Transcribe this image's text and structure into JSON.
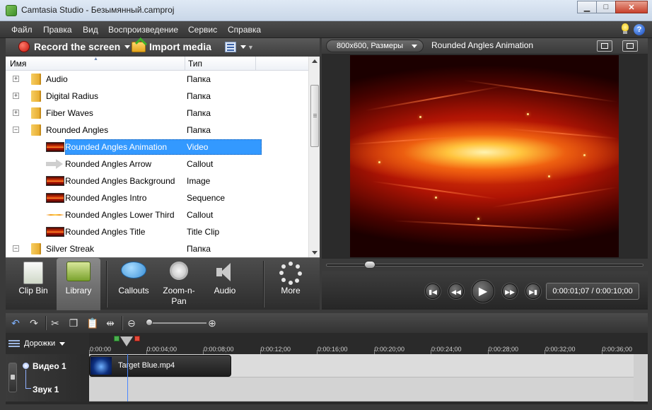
{
  "window": {
    "title": "Camtasia Studio - Безымянный.camproj"
  },
  "menu": [
    "Файл",
    "Правка",
    "Вид",
    "Воспроизведение",
    "Сервис",
    "Справка"
  ],
  "clip_toolbar": {
    "record_label": "Record the screen",
    "import_label": "Import media"
  },
  "tree": {
    "columns": {
      "name": "Имя",
      "type": "Тип"
    },
    "rows": [
      {
        "name": "Audio",
        "type": "Папка",
        "kind": "folder",
        "expander": "+"
      },
      {
        "name": "Digital Radius",
        "type": "Папка",
        "kind": "folder",
        "expander": "+"
      },
      {
        "name": "Fiber Waves",
        "type": "Папка",
        "kind": "folder",
        "expander": "+"
      },
      {
        "name": "Rounded Angles",
        "type": "Папка",
        "kind": "folder",
        "expander": "−"
      },
      {
        "name": "Rounded Angles Animation",
        "type": "Video",
        "kind": "fire",
        "selected": true
      },
      {
        "name": "Rounded Angles Arrow",
        "type": "Callout",
        "kind": "arrow"
      },
      {
        "name": "Rounded Angles Background",
        "type": "Image",
        "kind": "fire"
      },
      {
        "name": "Rounded Angles Intro",
        "type": "Sequence",
        "kind": "fire"
      },
      {
        "name": "Rounded Angles Lower Third",
        "type": "Callout",
        "kind": "line"
      },
      {
        "name": "Rounded Angles Title",
        "type": "Title Clip",
        "kind": "fire"
      },
      {
        "name": "Silver Streak",
        "type": "Папка",
        "kind": "folder",
        "expander": "−"
      }
    ]
  },
  "tasks": [
    {
      "id": "clip-bin",
      "label": "Clip Bin"
    },
    {
      "id": "library",
      "label": "Library",
      "active": true
    },
    {
      "id": "callouts",
      "label": "Callouts"
    },
    {
      "id": "zoom-n-pan",
      "label": "Zoom-n-\nPan"
    },
    {
      "id": "audio",
      "label": "Audio"
    },
    {
      "id": "more",
      "label": "More"
    }
  ],
  "preview": {
    "size_label": "800x600, Размеры",
    "title": "Rounded Angles Animation",
    "time": "0:00:01;07 / 0:00:10;00",
    "seek_position": 0.12
  },
  "timeline": {
    "tracks_label": "Дорожки",
    "ticks": [
      "0:00:00",
      "0:00:04;00",
      "0:00:08;00",
      "0:00:12;00",
      "0:00:16;00",
      "0:00:20;00",
      "0:00:24;00",
      "0:00:28;00",
      "0:00:32;00",
      "0:00:36;00"
    ],
    "video_track": "Видео 1",
    "audio_track": "Звук 1",
    "clip_name": "Target Blue.mp4"
  }
}
